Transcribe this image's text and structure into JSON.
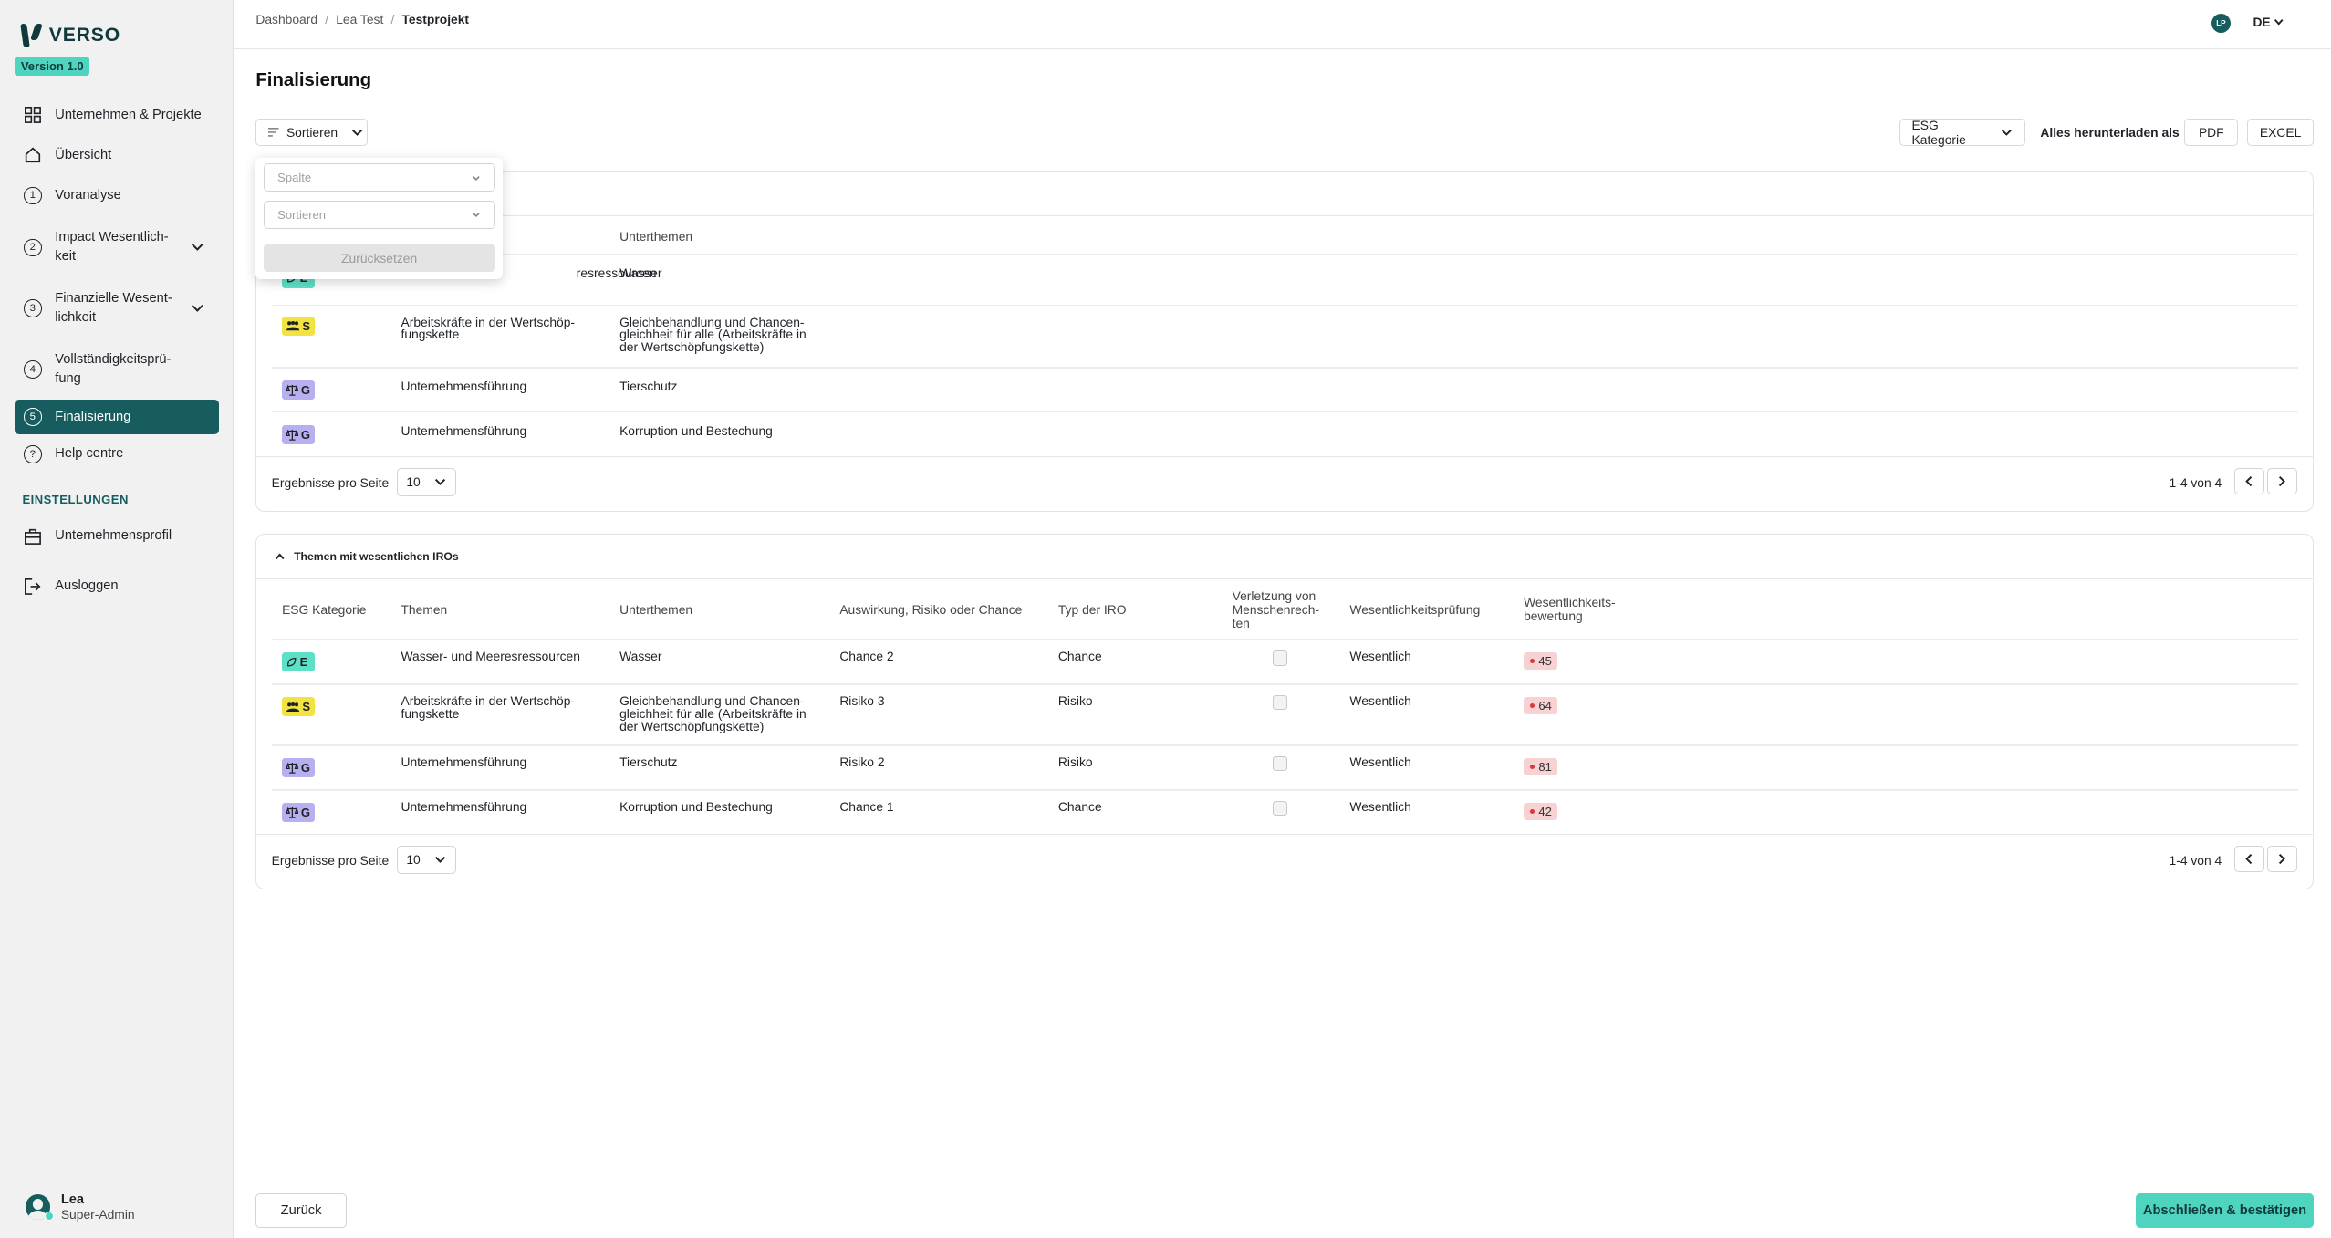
{
  "app": {
    "name": "VERSO",
    "version": "Version 1.0"
  },
  "sidebar": {
    "items": [
      {
        "label": "Unternehmen & Projekte"
      },
      {
        "label": "Übersicht"
      },
      {
        "label": "Voranalyse",
        "num": "1"
      },
      {
        "label": "Impact Wesentlich-keit",
        "num": "2"
      },
      {
        "label": "Finanzielle Wesent-lichkeit",
        "num": "3"
      },
      {
        "label": "Vollständigkeitsprü-fung",
        "num": "4"
      },
      {
        "label": "Finalisierung",
        "num": "5"
      },
      {
        "label": "Help centre",
        "num": "?"
      }
    ],
    "settings_label": "EINSTELLUNGEN",
    "settings_items": [
      {
        "label": "Unternehmensprofil"
      },
      {
        "label": "Ausloggen"
      }
    ],
    "user": {
      "name": "Lea",
      "role": "Super-Admin"
    }
  },
  "topbar": {
    "breadcrumb": [
      "Dashboard",
      "Lea Test",
      "Testprojekt"
    ],
    "avatar_initials": "LP",
    "language": "DE"
  },
  "page": {
    "title": "Finalisierung",
    "sort_label": "Sortieren",
    "esg_filter_label": "ESG Kategorie",
    "download_label": "Alles herunterladen als",
    "pdf_label": "PDF",
    "excel_label": "EXCEL"
  },
  "sort_popover": {
    "column_placeholder": "Spalte",
    "sort_placeholder": "Sortieren",
    "reset_label": "Zurücksetzen"
  },
  "table1": {
    "headers": {
      "subtopics": "Unterthemen"
    },
    "rows": [
      {
        "esg": "E",
        "topic": "Wasser- und Meeresressourcen",
        "topic_visible": "resressourcen",
        "subtopic": "Wasser"
      },
      {
        "esg": "S",
        "topic": "Arbeitskräfte in der Wertschöp-fungskette",
        "subtopic": "Gleichbehandlung und Chancen-gleichheit für alle (Arbeitskräfte in der Wertschöpfungskette)"
      },
      {
        "esg": "G",
        "topic": "Unternehmensführung",
        "subtopic": "Tierschutz"
      },
      {
        "esg": "G",
        "topic": "Unternehmensführung",
        "subtopic": "Korruption und Bestechung"
      }
    ],
    "per_page_label": "Ergebnisse pro Seite",
    "per_page_value": "10",
    "range": "1-4 von 4"
  },
  "table2": {
    "title": "Themen mit wesentlichen IROs",
    "headers": {
      "esg": "ESG Kategorie",
      "topics": "Themen",
      "subtopics": "Unterthemen",
      "impact": "Auswirkung, Risiko oder Chance",
      "iro_type": "Typ der IRO",
      "human_rights": "Verletzung von Menschenrech-ten",
      "check": "Wesentlichkeitsprüfung",
      "rating": "Wesentlichkeits-bewertung"
    },
    "rows": [
      {
        "esg": "E",
        "topic": "Wasser- und Meeresressourcen",
        "subtopic": "Wasser",
        "impact": "Chance 2",
        "iro_type": "Chance",
        "check": "Wesentlich",
        "score": "45"
      },
      {
        "esg": "S",
        "topic": "Arbeitskräfte in der Wertschöp-fungskette",
        "subtopic": "Gleichbehandlung und Chancen-gleichheit für alle (Arbeitskräfte in der Wertschöpfungskette)",
        "impact": "Risiko 3",
        "iro_type": "Risiko",
        "check": "Wesentlich",
        "score": "64"
      },
      {
        "esg": "G",
        "topic": "Unternehmensführung",
        "subtopic": "Tierschutz",
        "impact": "Risiko 2",
        "iro_type": "Risiko",
        "check": "Wesentlich",
        "score": "81"
      },
      {
        "esg": "G",
        "topic": "Unternehmensführung",
        "subtopic": "Korruption und Bestechung",
        "impact": "Chance 1",
        "iro_type": "Chance",
        "check": "Wesentlich",
        "score": "42"
      }
    ],
    "per_page_label": "Ergebnisse pro Seite",
    "per_page_value": "10",
    "range": "1-4 von 4"
  },
  "bottombar": {
    "back_label": "Zurück",
    "confirm_label": "Abschließen & bestätigen"
  },
  "colors": {
    "accent": "#4fd4c0",
    "primary": "#175d5f",
    "env": "#5ee0c8",
    "social": "#f2e341",
    "gov": "#b6b0f0",
    "score_bg": "#f8d2d2"
  }
}
